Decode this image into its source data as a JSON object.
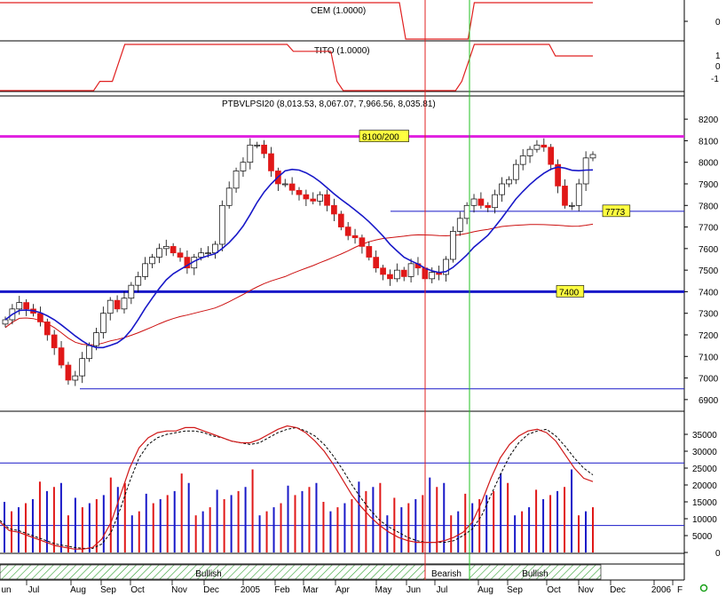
{
  "chart_data": [
    {
      "type": "line",
      "panel": "cem",
      "title": "CEM (1.0000)",
      "yticks": [
        "0"
      ],
      "values": [
        1,
        1,
        1,
        1,
        1,
        1,
        1,
        1,
        1,
        1,
        1,
        1,
        1,
        1,
        1,
        1,
        1,
        1,
        1,
        1,
        1,
        1,
        1,
        1,
        1,
        1,
        1,
        1,
        1,
        1,
        1,
        1,
        1,
        1,
        1,
        1,
        1,
        1,
        1,
        1,
        1,
        1,
        1,
        1,
        1,
        1,
        1,
        1,
        1,
        1,
        1,
        1,
        1,
        1,
        1,
        1,
        1,
        1,
        1,
        1,
        1,
        1,
        1,
        1,
        1,
        0,
        0,
        0,
        0,
        0,
        0,
        0,
        0,
        0,
        0,
        0,
        1,
        1,
        1,
        1,
        1,
        1,
        1,
        1,
        1,
        1,
        1,
        1,
        1,
        1,
        1,
        1,
        1,
        1,
        1,
        1
      ]
    },
    {
      "type": "line",
      "panel": "tito",
      "title": "TITO (1.0000)",
      "yticks": [
        "1",
        "0",
        "-1"
      ],
      "values": [
        -1,
        -1,
        -1,
        -1,
        -1,
        -1,
        -1,
        -1,
        -1,
        -1,
        -1,
        -1,
        -1,
        -1,
        -1,
        -1,
        -0.6,
        -0.6,
        -0.6,
        0.2,
        1,
        1,
        1,
        1,
        1,
        1,
        1,
        1,
        1,
        1,
        1,
        1,
        1,
        1,
        1,
        1,
        1,
        1,
        1,
        1,
        1,
        1,
        1,
        1,
        1,
        1,
        1,
        0.7,
        0.7,
        0.7,
        0.7,
        0.7,
        0.7,
        0.7,
        -0.6,
        -1,
        -1,
        -1,
        -1,
        -1,
        -1,
        -1,
        -1,
        -1,
        -1,
        -1,
        -1,
        -1,
        -1,
        -1,
        -1,
        -1,
        -1,
        -1,
        -0.6,
        0.2,
        1,
        1,
        1,
        1,
        1,
        1,
        1,
        1,
        1,
        1,
        1,
        1,
        1,
        0.5,
        0.5,
        0.5,
        0.5,
        0.5,
        0.5,
        0.5
      ]
    },
    {
      "type": "candlestick",
      "panel": "price",
      "title": "PTBVLPSI20 (8,013.53, 8,067.07, 7,966.56, 8,035.81)",
      "ylim": [
        6850,
        8250
      ],
      "yticks": [
        6900,
        7000,
        7100,
        7200,
        7300,
        7400,
        7500,
        7600,
        7700,
        7800,
        7900,
        8000,
        8100,
        8200
      ],
      "x_labels": [
        "un",
        "Jul",
        "Aug",
        "Sep",
        "Oct",
        "Nov",
        "Dec",
        "2005",
        "Feb",
        "Mar",
        "Apr",
        "May",
        "Jun",
        "Jul",
        "Aug",
        "Sep",
        "Oct",
        "Nov",
        "Dec",
        "2006",
        "F"
      ],
      "close": [
        7270,
        7320,
        7350,
        7320,
        7300,
        7260,
        7200,
        7140,
        7060,
        6990,
        7010,
        7090,
        7150,
        7210,
        7300,
        7360,
        7320,
        7370,
        7430,
        7470,
        7530,
        7560,
        7600,
        7610,
        7580,
        7560,
        7510,
        7560,
        7580,
        7580,
        7620,
        7800,
        7880,
        7960,
        8000,
        8080,
        8080,
        8040,
        7960,
        7900,
        7900,
        7870,
        7850,
        7830,
        7820,
        7850,
        7800,
        7760,
        7700,
        7660,
        7650,
        7610,
        7560,
        7510,
        7480,
        7460,
        7500,
        7470,
        7530,
        7510,
        7460,
        7490,
        7480,
        7550,
        7680,
        7740,
        7800,
        7830,
        7800,
        7790,
        7850,
        7900,
        7920,
        7990,
        8030,
        8060,
        8080,
        8070,
        7990,
        7890,
        7800,
        7800,
        7900,
        8020,
        8036
      ],
      "trend_lines": [
        {
          "level": 8120,
          "label": "8100/200"
        },
        {
          "level": 7773,
          "label": "7773"
        },
        {
          "level": 7400,
          "label": "7400"
        },
        {
          "level": 6950,
          "label": ""
        }
      ]
    },
    {
      "type": "bar",
      "panel": "oscillator",
      "yticks": [
        0,
        5000,
        10000,
        15000,
        20000,
        25000,
        30000,
        35000
      ],
      "ylim": [
        0,
        40000
      ],
      "bands": [
        "Bullish",
        "Bearish",
        "Bullish"
      ],
      "red_line": [
        9000,
        6500,
        6000,
        5000,
        4000,
        3000,
        2000,
        1500,
        1000,
        1000,
        1500,
        4000,
        9000,
        17000,
        25000,
        31000,
        34000,
        35500,
        36000,
        36000,
        37000,
        37000,
        36000,
        35000,
        34000,
        33000,
        32500,
        32500,
        33500,
        35000,
        36500,
        37500,
        37000,
        35500,
        33000,
        30000,
        26000,
        21500,
        17000,
        13500,
        10500,
        8000,
        6000,
        4500,
        3500,
        3000,
        3000,
        3000,
        3500,
        4500,
        6000,
        9000,
        15000,
        22000,
        28000,
        32000,
        34500,
        36000,
        36500,
        35500,
        33000,
        29000,
        25000,
        22000,
        21000
      ],
      "black_line": [
        9500,
        7000,
        6500,
        5500,
        4500,
        3500,
        2500,
        2000,
        1500,
        1200,
        1200,
        2500,
        6000,
        13000,
        21000,
        28000,
        32000,
        34000,
        35000,
        35500,
        36000,
        36000,
        35500,
        34500,
        34000,
        33000,
        32500,
        32000,
        32500,
        34000,
        35500,
        36500,
        37000,
        36000,
        34500,
        32000,
        28500,
        24500,
        20000,
        16000,
        12500,
        9500,
        7500,
        6000,
        4500,
        3500,
        3000,
        3000,
        3000,
        3500,
        5000,
        7000,
        11000,
        17000,
        23000,
        28500,
        32500,
        35000,
        36000,
        36500,
        34500,
        31500,
        28000,
        25000,
        23000
      ]
    }
  ]
}
